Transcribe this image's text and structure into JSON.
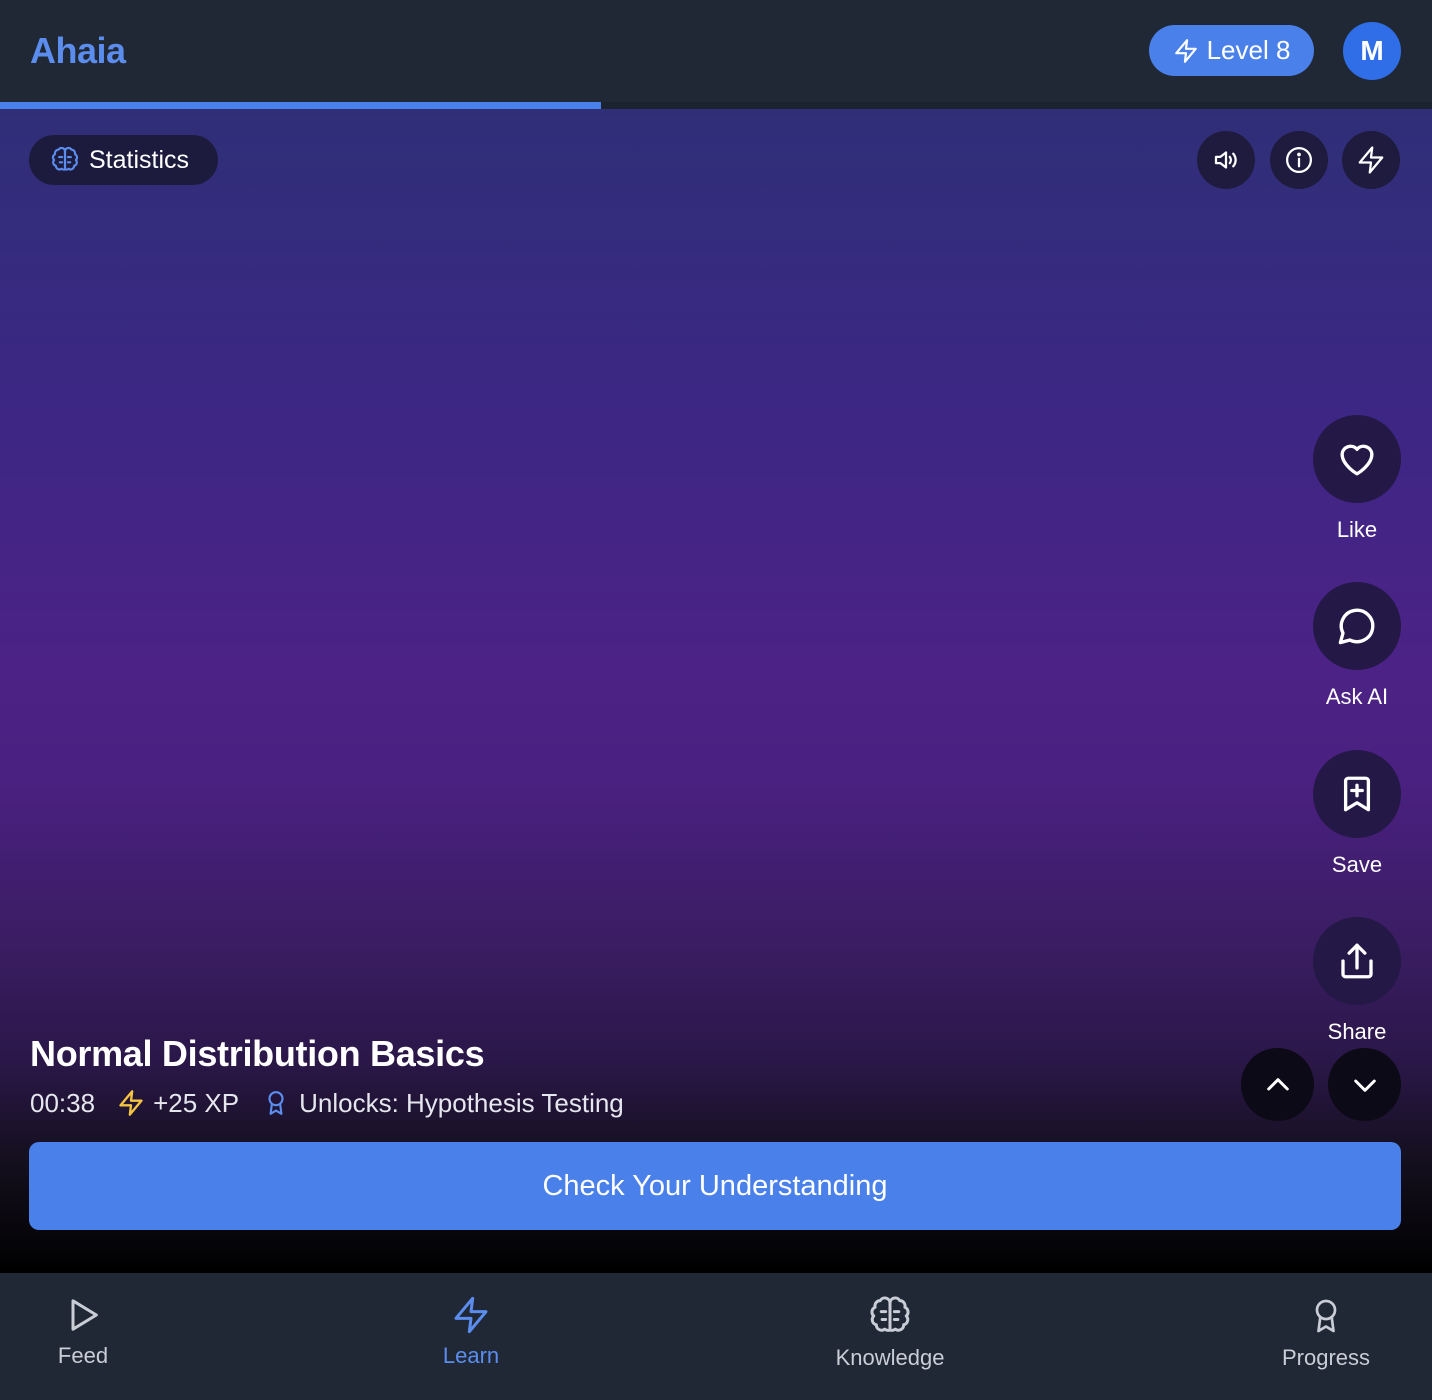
{
  "app": {
    "name": "Ahaia"
  },
  "header": {
    "level_label": "Level 8",
    "avatar_initial": "M",
    "progress": 0.42
  },
  "topic": {
    "label": "Statistics",
    "icon": "brain-icon"
  },
  "top_actions": [
    {
      "name": "sound-button",
      "icon": "speaker-icon"
    },
    {
      "name": "info-button",
      "icon": "info-icon"
    },
    {
      "name": "boost-button",
      "icon": "lightning-icon"
    }
  ],
  "side_actions": {
    "like": {
      "label": "Like",
      "icon": "heart-icon"
    },
    "ask_ai": {
      "label": "Ask AI",
      "icon": "chat-icon"
    },
    "save": {
      "label": "Save",
      "icon": "bookmark-plus-icon"
    },
    "share": {
      "label": "Share",
      "icon": "share-icon"
    }
  },
  "lesson": {
    "title": "Normal Distribution Basics",
    "duration": "00:38",
    "xp": "+25 XP",
    "unlocks": "Unlocks: Hypothesis Testing"
  },
  "cta": {
    "label": "Check Your Understanding"
  },
  "bottom_nav": {
    "active": "learn",
    "items": [
      {
        "key": "feed",
        "label": "Feed",
        "icon": "play-icon"
      },
      {
        "key": "learn",
        "label": "Learn",
        "icon": "lightning-icon"
      },
      {
        "key": "knowledge",
        "label": "Knowledge",
        "icon": "brain-icon"
      },
      {
        "key": "progress",
        "label": "Progress",
        "icon": "award-icon"
      }
    ]
  },
  "colors": {
    "accent": "#4a80ea",
    "logo": "#5b8def",
    "xp_bolt": "#f5c542",
    "unlock_icon": "#5b8def",
    "chrome": "#212835"
  }
}
